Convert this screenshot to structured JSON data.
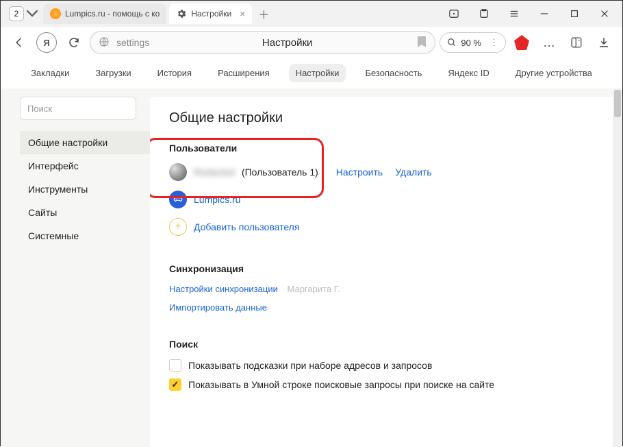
{
  "titlebar": {
    "tab_count": "2",
    "tabs": [
      {
        "title": "Lumpics.ru - помощь с ко",
        "active": false
      },
      {
        "title": "Настройки",
        "active": true
      }
    ]
  },
  "toolbar": {
    "url": "settings",
    "page_title": "Настройки",
    "zoom": "90 %"
  },
  "topnav": {
    "items": [
      "Закладки",
      "Загрузки",
      "История",
      "Расширения",
      "Настройки",
      "Безопасность",
      "Яндекс ID",
      "Другие устройства"
    ],
    "active_index": 4
  },
  "sidebar": {
    "search_placeholder": "Поиск",
    "items": [
      "Общие настройки",
      "Интерфейс",
      "Инструменты",
      "Сайты",
      "Системные"
    ],
    "active_index": 0
  },
  "main": {
    "heading": "Общие настройки",
    "users_section": {
      "title": "Пользователи",
      "primary": {
        "name_hidden": "Redacted",
        "suffix": "(Пользователь 1)",
        "configure": "Настроить",
        "delete": "Удалить"
      },
      "secondary": {
        "name": "Lumpics.ru"
      },
      "add_label": "Добавить пользователя"
    },
    "sync_section": {
      "title": "Синхронизация",
      "settings_link": "Настройки синхронизации",
      "account": "Маргарита Г.",
      "import_link": "Импортировать данные"
    },
    "search_section": {
      "title": "Поиск",
      "opt1": "Показывать подсказки при наборе адресов и запросов",
      "opt2": "Показывать в Умной строке поисковые запросы при поиске на сайте"
    }
  }
}
